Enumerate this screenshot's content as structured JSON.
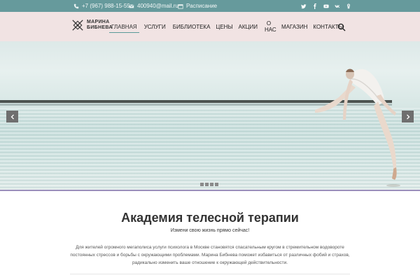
{
  "topbar": {
    "phone": "+7 (967) 988-15-59",
    "email": "400940@mail.ru",
    "schedule": "Расписание",
    "social_icons": [
      "twitter-icon",
      "facebook-icon",
      "youtube-icon",
      "vk-icon",
      "odnoklassniki-icon"
    ],
    "background": "#669a9c"
  },
  "header": {
    "logo_line1": "МАРИНА",
    "logo_line2": "БИБНЕВА",
    "nav": [
      {
        "label": "Главная",
        "active": true
      },
      {
        "label": "Услуги"
      },
      {
        "label": "Библиотека"
      },
      {
        "label": "Цены"
      },
      {
        "label": "Акции"
      },
      {
        "label_line1": "О",
        "label_line2": "нас"
      },
      {
        "label": "Магазин"
      },
      {
        "label": "Контакты"
      }
    ],
    "background": "#f1e3e3",
    "accent": "#5a9a98"
  },
  "slider": {
    "prev_icon": "chevron-left-icon",
    "next_icon": "chevron-right-icon",
    "slide_count": 4
  },
  "content": {
    "title": "Академия телесной терапии",
    "subtitle": "Измени свою жизнь прямо сейчас!",
    "paragraph": "Для жителей огромного мегаполиса услуги психолога в Москве становятся спасательным кругом в стремительном водовороте постоянных стрессов и борьбы с окружающими проблемами. Марина Бибнева поможет избавиться от различных фобий и страхов, радикально изменить ваше отношение к окружающей действительности."
  }
}
